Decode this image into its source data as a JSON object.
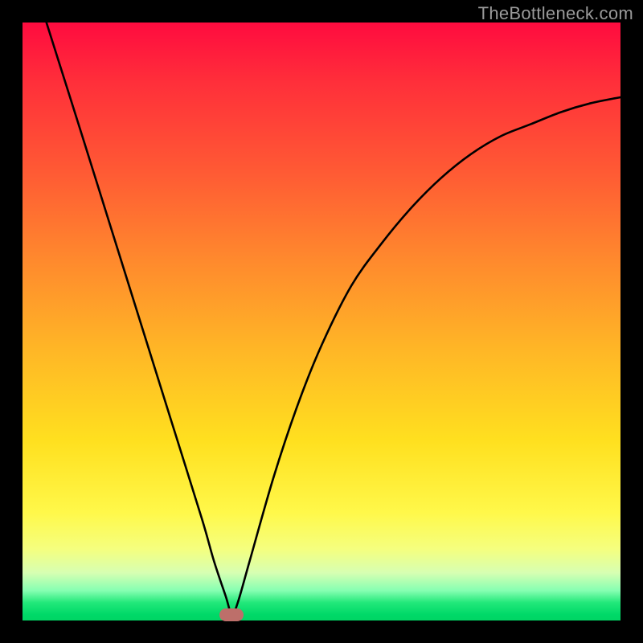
{
  "watermark": "TheBottleneck.com",
  "chart_data": {
    "type": "line",
    "title": "",
    "xlabel": "",
    "ylabel": "",
    "xlim": [
      0,
      100
    ],
    "ylim": [
      0,
      100
    ],
    "grid": false,
    "legend": false,
    "series": [
      {
        "name": "curve",
        "x": [
          4,
          10,
          15,
          20,
          25,
          30,
          32,
          34,
          35,
          36,
          38,
          42,
          46,
          50,
          55,
          60,
          65,
          70,
          75,
          80,
          85,
          90,
          95,
          100
        ],
        "values": [
          100,
          81,
          65,
          49,
          33,
          17,
          10,
          4,
          1,
          3,
          10,
          24,
          36,
          46,
          56,
          63,
          69,
          74,
          78,
          81,
          83,
          85,
          86.5,
          87.5
        ]
      }
    ],
    "marker": {
      "x": 35,
      "y": 1,
      "color": "#bd6f6a"
    },
    "gradient_stops": [
      {
        "pos": 0.0,
        "color": "#ff0b3f"
      },
      {
        "pos": 0.55,
        "color": "#ffb726"
      },
      {
        "pos": 0.82,
        "color": "#fff84a"
      },
      {
        "pos": 1.0,
        "color": "#00d564"
      }
    ]
  }
}
